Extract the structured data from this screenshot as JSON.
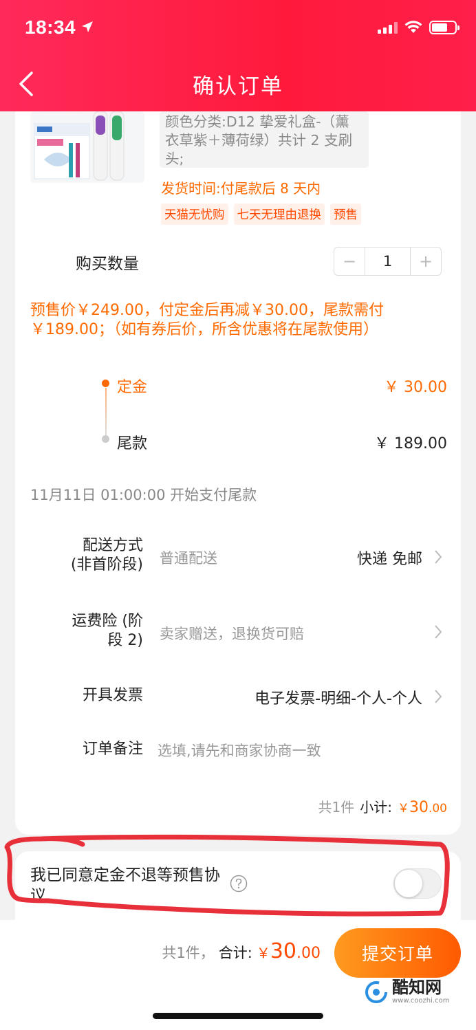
{
  "status_bar": {
    "time": "18:34"
  },
  "header": {
    "title": "确认订单"
  },
  "product": {
    "spec": "颜色分类:D12 挚爱礼盒-（薰衣草紫＋薄荷绿）共计 2 支刷头;",
    "ship_time": "发货时间:付尾款后 8 天内",
    "tags": [
      "天猫无忧购",
      "七天无理由退换",
      "预售"
    ]
  },
  "quantity": {
    "label": "购买数量",
    "minus": "−",
    "value": "1",
    "plus": "+"
  },
  "presale_note": "预售价￥249.00，付定金后再减￥30.00，尾款需付￥189.00；（如有券后价，所含优惠将在尾款使用）",
  "payment_stages": {
    "deposit_label": "定金",
    "deposit_amount": "￥ 30.00",
    "final_label": "尾款",
    "final_amount": "￥ 189.00",
    "final_start": "11月11日 01:00:00 开始支付尾款"
  },
  "rows": {
    "delivery": {
      "label": "配送方式\n(非首阶段)",
      "value": "普通配送",
      "detail": "快递 免邮"
    },
    "insurance": {
      "label": "运费险 (阶\n段 2)",
      "value": "卖家赠送，退换货可赔"
    },
    "invoice": {
      "label": "开具发票",
      "value": "电子发票-明细-个人-个人"
    },
    "note": {
      "label": "订单备注",
      "placeholder": "选填,请先和商家协商一致"
    }
  },
  "summary": {
    "count": "共1件",
    "subtotal_label": "小计:",
    "yen": "￥",
    "amount": "30",
    "decimals": ".00"
  },
  "agreement": {
    "text": "我已同意定金不退等预售协议",
    "toggle_on": false
  },
  "footer": {
    "count": "共1件，",
    "total_label": "合计:",
    "yen": "￥",
    "amount": "30",
    "decimals": ".00",
    "submit_label": "提交订单"
  },
  "watermark": {
    "name": "酷知网",
    "url": "www.coozhi.com"
  },
  "colors": {
    "header_red": "#ff1a3c",
    "accent_orange": "#ff6a00",
    "annotation_red": "#e8303a"
  }
}
